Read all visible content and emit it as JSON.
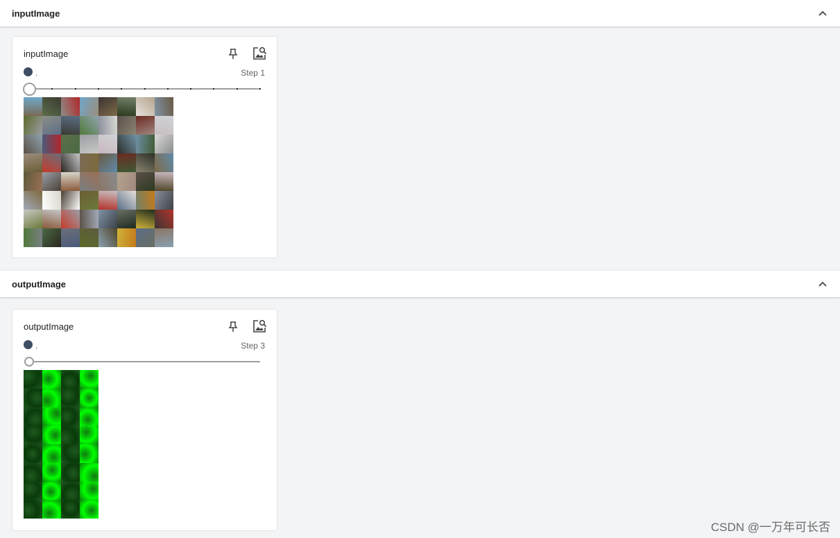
{
  "sections": [
    {
      "title": "inputImage",
      "card": {
        "title": "inputImage",
        "run_name": ".",
        "step_label": "Step 1",
        "slider_fraction": 0.0,
        "slider_ticks": 10,
        "pin_icon": "pin-icon",
        "actions_icon": "image-search-icon"
      }
    },
    {
      "title": "outputImage",
      "card": {
        "title": "outputImage",
        "run_name": ".",
        "step_label": "Step 3",
        "slider_fraction": 0.0,
        "pin_icon": "pin-icon",
        "actions_icon": "image-search-icon"
      }
    }
  ],
  "colors": {
    "run_dot": "#3f4d63",
    "header_bg": "#ffffff",
    "page_bg": "#f3f4f6",
    "green_bright": "#00ff00",
    "green_dark": "#0a3a0a"
  },
  "watermark": "CSDN @一万年可长否"
}
